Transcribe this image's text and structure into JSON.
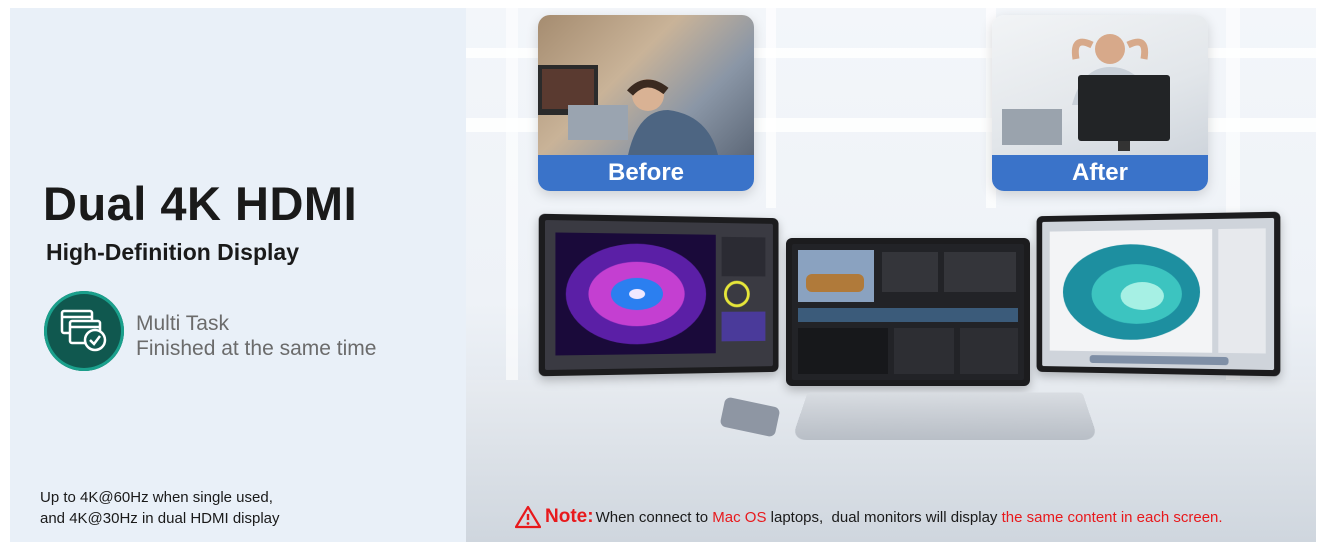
{
  "headline": {
    "title": "Dual 4K HDMI",
    "subtitle": "High-Definition Display"
  },
  "feature": {
    "icon": "multi-window-check-icon",
    "line1": "Multi Task",
    "line2": "Finished at the same time"
  },
  "footnote": {
    "line1": "Up to 4K@60Hz when single used,",
    "line2": "and 4K@30Hz in dual HDMI display"
  },
  "comparison": {
    "before_label": "Before",
    "after_label": "After"
  },
  "note": {
    "icon": "warning-triangle-icon",
    "label": "Note:",
    "text1": "When connect to ",
    "highlight1": "Mac OS",
    "text2": " laptops,  dual monitors will display ",
    "highlight2": "the same content in each screen."
  },
  "colors": {
    "background": "#e9f0f8",
    "label_blue": "#3a73c9",
    "icon_green": "#10584f",
    "warning_red": "#e8191c"
  }
}
